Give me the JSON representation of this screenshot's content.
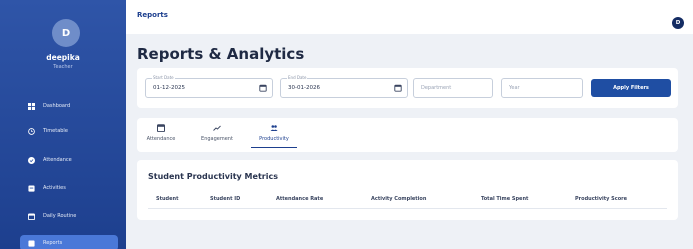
{
  "sidebar": {
    "avatar_initial": "D",
    "user_name": "deepika",
    "user_role": "Teacher",
    "items": [
      {
        "label": "Dashboard",
        "icon": "dashboard-icon"
      },
      {
        "label": "Timetable",
        "icon": "clock-icon"
      },
      {
        "label": "Attendance",
        "icon": "check-circle-icon"
      },
      {
        "label": "Activities",
        "icon": "activities-icon"
      },
      {
        "label": "Daily Routine",
        "icon": "calendar-icon"
      },
      {
        "label": "Reports",
        "icon": "reports-icon",
        "active": true
      }
    ]
  },
  "header": {
    "title": "Reports",
    "avatar_initial": "D"
  },
  "page_title": "Reports & Analytics",
  "filters": {
    "start_date_label": "Start Date",
    "start_date_value": "01-12-2025",
    "end_date_label": "End Date",
    "end_date_value": "30-01-2026",
    "department_placeholder": "Department",
    "year_placeholder": "Year",
    "apply_label": "Apply Filters"
  },
  "tabs": [
    {
      "label": "Attendance",
      "icon": "calendar-icon"
    },
    {
      "label": "Engagement",
      "icon": "trend-icon"
    },
    {
      "label": "Productivity",
      "icon": "people-icon",
      "active": true
    }
  ],
  "table": {
    "title": "Student Productivity Metrics",
    "columns": [
      "Student",
      "Student ID",
      "Attendance Rate",
      "Activity Completion",
      "Total Time Spent",
      "Productivity Score"
    ]
  },
  "colors": {
    "sidebar": "#2f55a8",
    "accent": "#1d3f8e",
    "button": "#1f4ea3",
    "background": "#eef1f6"
  }
}
